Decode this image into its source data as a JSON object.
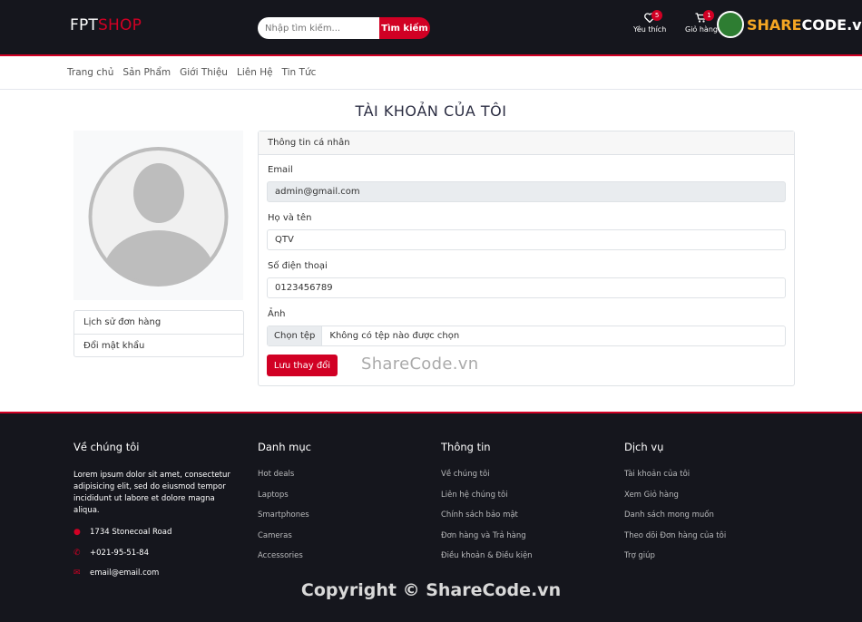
{
  "header": {
    "logo_part1": "FPT",
    "logo_part2": "SHOP",
    "search_placeholder": "Nhập tìm kiếm...",
    "search_button": "Tìm kiếm",
    "wishlist_label": "Yêu thích",
    "wishlist_count": "5",
    "cart_label": "Giỏ hàng",
    "cart_count": "1",
    "watermark_part1": "SHARE",
    "watermark_part2": "CODE.vn"
  },
  "nav": {
    "items": [
      "Trang chủ",
      "Sản Phẩm",
      "Giới Thiệu",
      "Liên Hệ",
      "Tin Tức"
    ]
  },
  "page": {
    "title": "TÀI KHOẢN CỦA TÔI"
  },
  "sidebar": {
    "menu": [
      "Lịch sử đơn hàng",
      "Đổi mật khẩu"
    ]
  },
  "form": {
    "header": "Thông tin cá nhân",
    "email_label": "Email",
    "email_value": "admin@gmail.com",
    "name_label": "Họ và tên",
    "name_value": "QTV",
    "phone_label": "Số điện thoại",
    "phone_value": "0123456789",
    "image_label": "Ảnh",
    "file_button": "Chọn tệp",
    "file_status": "Không có tệp nào được chọn",
    "save_button": "Lưu thay đổi"
  },
  "watermark_mid": "ShareCode.vn",
  "footer": {
    "about": {
      "title": "Về chúng tôi",
      "text": "Lorem ipsum dolor sit amet, consectetur adipisicing elit, sed do eiusmod tempor incididunt ut labore et dolore magna aliqua.",
      "address": "1734 Stonecoal Road",
      "phone": "+021-95-51-84",
      "email": "email@email.com"
    },
    "categories": {
      "title": "Danh mục",
      "items": [
        "Hot deals",
        "Laptops",
        "Smartphones",
        "Cameras",
        "Accessories"
      ]
    },
    "info": {
      "title": "Thông tin",
      "items": [
        "Về chúng tôi",
        "Liên hệ chúng tôi",
        "Chính sách bảo mật",
        "Đơn hàng và Trả hàng",
        "Điều khoản & Điều kiện"
      ]
    },
    "services": {
      "title": "Dịch vụ",
      "items": [
        "Tài khoản của tôi",
        "Xem Giỏ hàng",
        "Danh sách mong muốn",
        "Theo dõi Đơn hàng của tôi",
        "Trợ giúp"
      ]
    },
    "copyright": "Copyright © ShareCode.vn"
  },
  "colors": {
    "accent": "#d10024",
    "dark": "#15161d"
  }
}
